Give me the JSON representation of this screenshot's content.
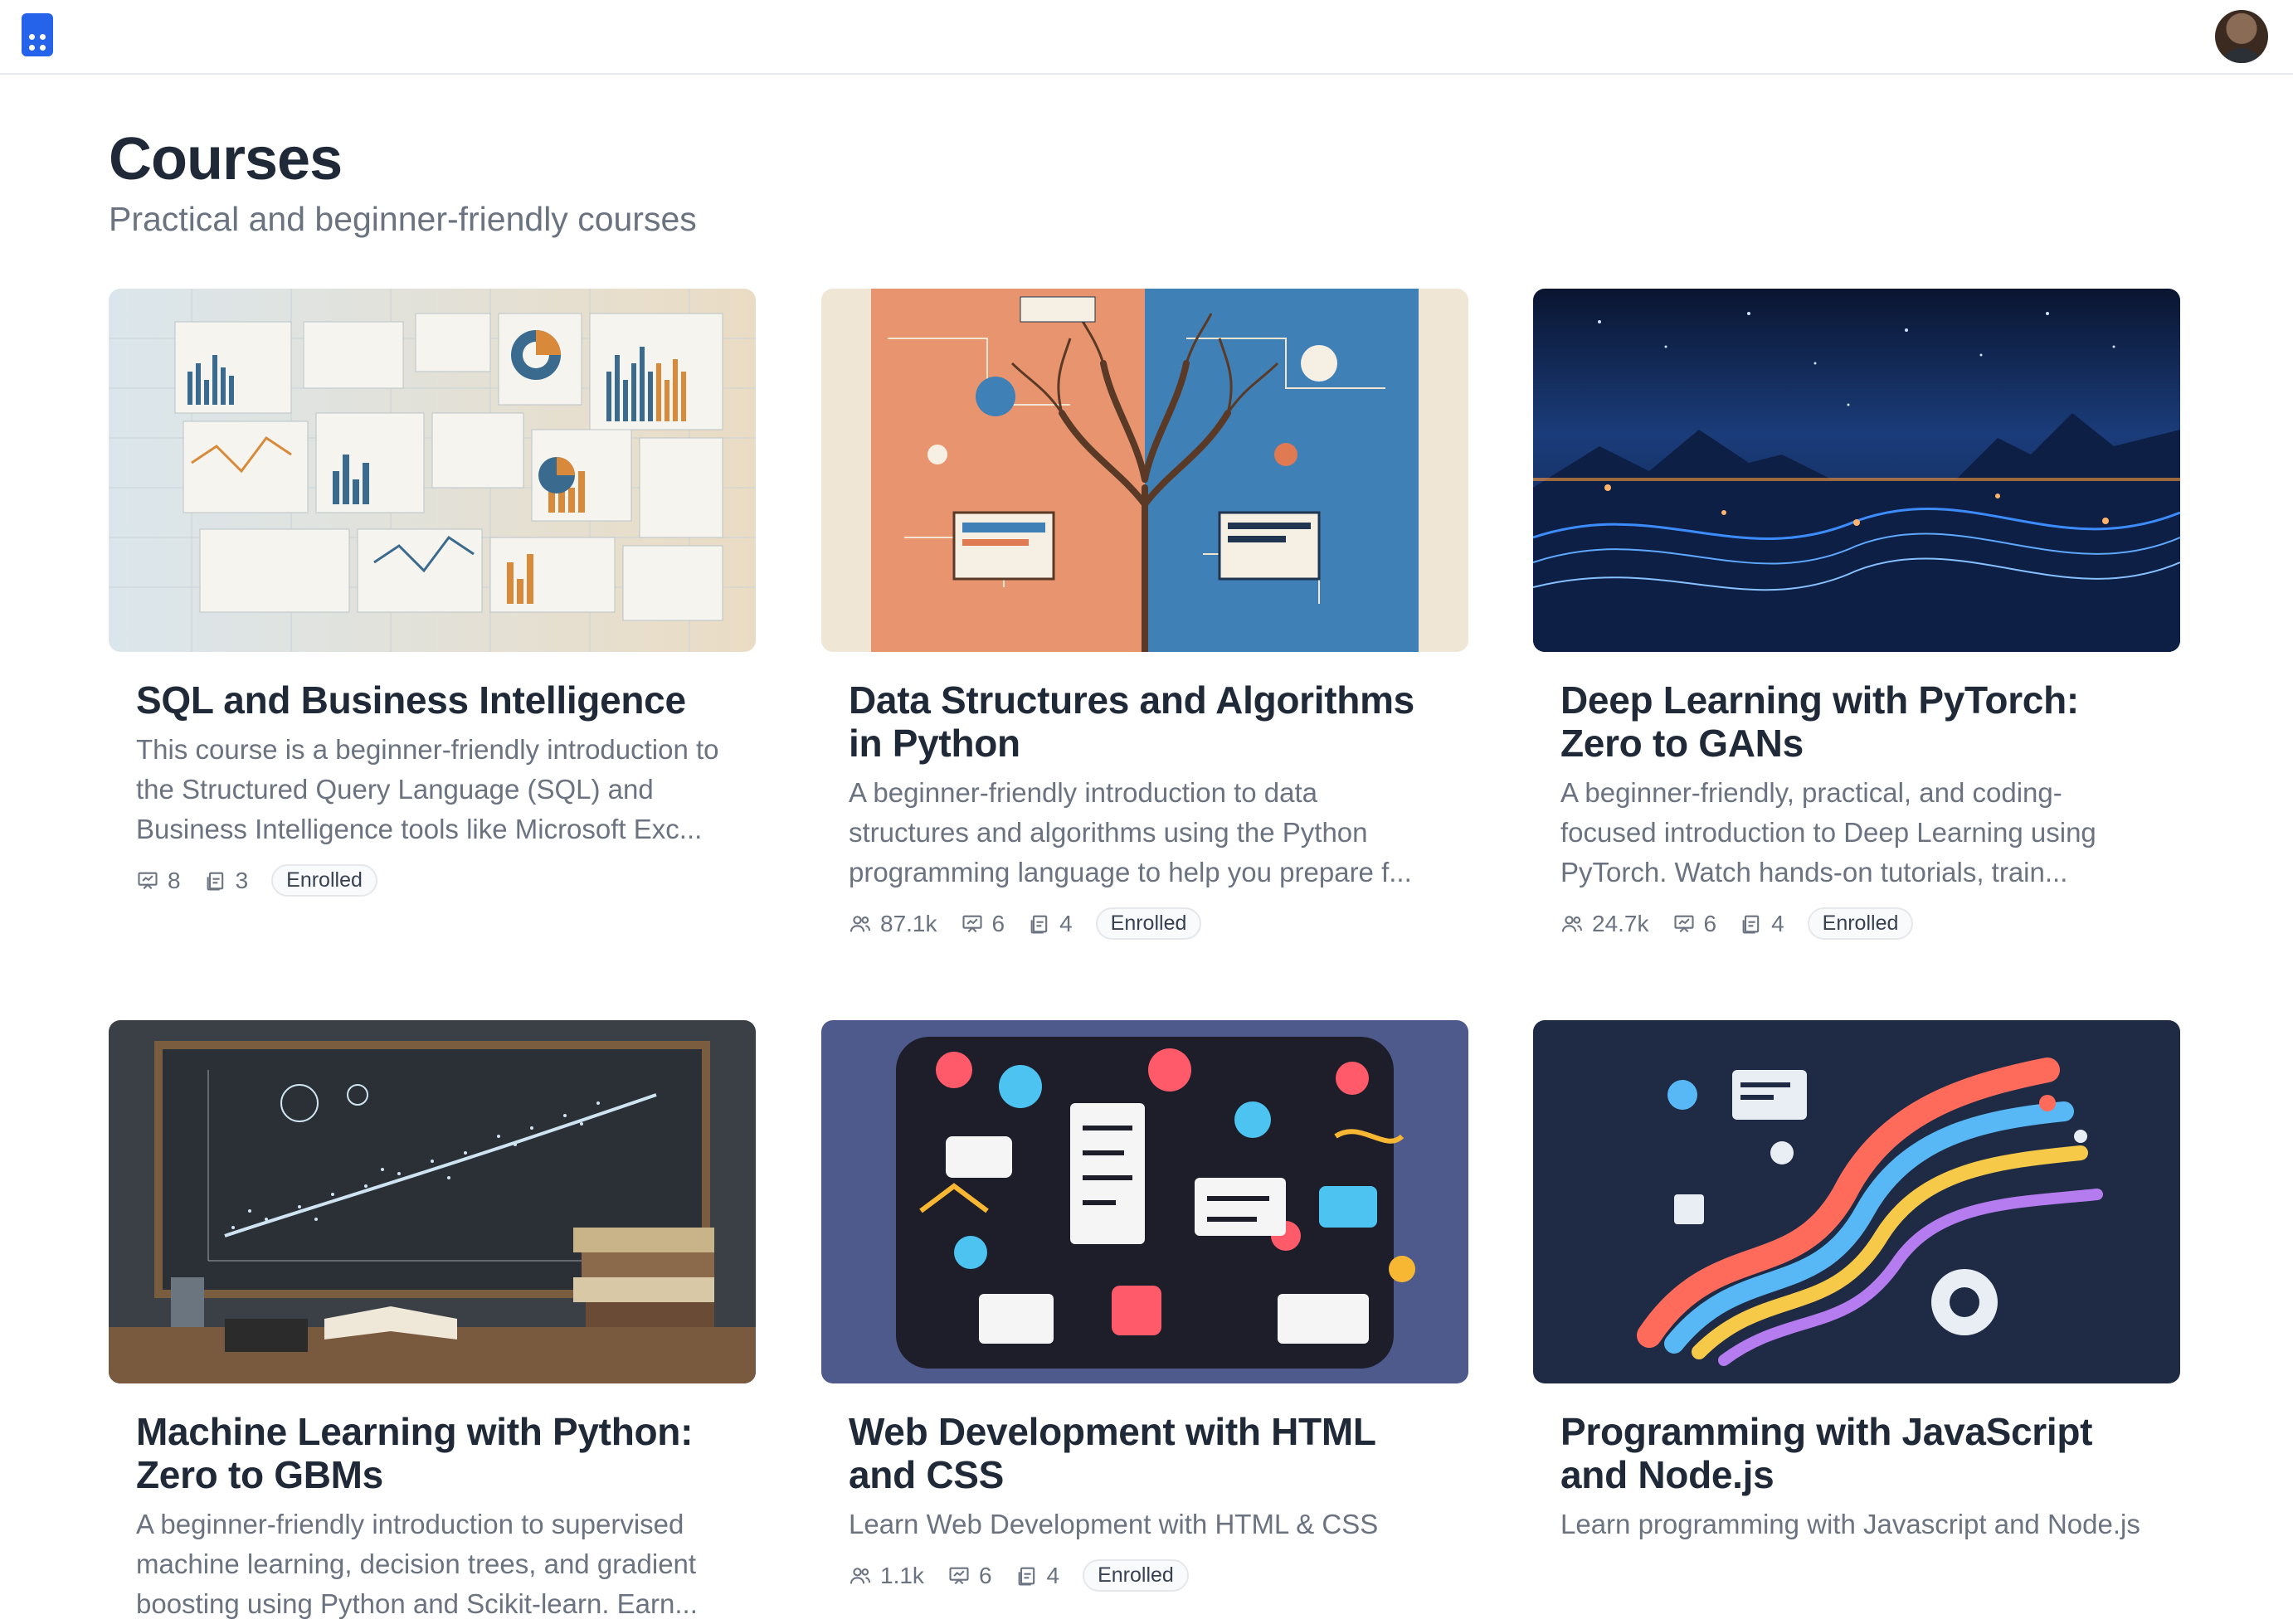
{
  "header": {
    "title": "Courses",
    "subtitle": "Practical and beginner-friendly courses"
  },
  "courses": [
    {
      "title": "SQL and Business Intelligence",
      "description": "This course is a beginner-friendly introduction to the Structured Query Language (SQL) and Business Intelligence tools like Microsoft Exc...",
      "learners": "",
      "lessons": "8",
      "assignments": "3",
      "badge": "Enrolled",
      "colors": {
        "bg": "#e9ecea",
        "accent": "#d9893a",
        "accent2": "#3a6b8f"
      }
    },
    {
      "title": "Data Structures and Algorithms in Python",
      "description": "A beginner-friendly introduction to data structures and algorithms using the Python programming language to help you prepare f...",
      "learners": "87.1k",
      "lessons": "6",
      "assignments": "4",
      "badge": "Enrolled",
      "colors": {
        "bg": "#efe6d6",
        "accent": "#e07a52",
        "accent2": "#3b7db4"
      }
    },
    {
      "title": "Deep Learning with PyTorch: Zero to GANs",
      "description": "A beginner-friendly, practical, and coding-focused introduction to Deep Learning using PyTorch. Watch hands-on tutorials, train...",
      "learners": "24.7k",
      "lessons": "6",
      "assignments": "4",
      "badge": "Enrolled",
      "colors": {
        "bg": "#0b1a3a",
        "accent": "#3d8cff",
        "accent2": "#ff9a3c"
      }
    },
    {
      "title": "Machine Learning with Python: Zero to GBMs",
      "description": "A beginner-friendly introduction to supervised machine learning, decision trees, and gradient boosting using Python and Scikit-learn. Earn...",
      "learners": "",
      "lessons": "",
      "assignments": "",
      "badge": "",
      "colors": {
        "bg": "#2b3238",
        "accent": "#cfe4f2",
        "accent2": "#8a6a4a"
      }
    },
    {
      "title": "Web Development with HTML and CSS",
      "description": "Learn Web Development with HTML & CSS",
      "learners": "1.1k",
      "lessons": "6",
      "assignments": "4",
      "badge": "Enrolled",
      "colors": {
        "bg": "#4e5a8c",
        "accent": "#ff5a6a",
        "accent2": "#4cc3f0"
      }
    },
    {
      "title": "Programming with JavaScript and Node.js",
      "description": "Learn programming with Javascript and Node.js",
      "learners": "",
      "lessons": "",
      "assignments": "",
      "badge": "",
      "colors": {
        "bg": "#1f2b44",
        "accent": "#ff6b5a",
        "accent2": "#58b8f5"
      }
    }
  ],
  "icons": {
    "logo": "app-logo-icon",
    "learners": "users-icon",
    "lessons": "presentation-icon",
    "assignments": "assignment-icon"
  }
}
